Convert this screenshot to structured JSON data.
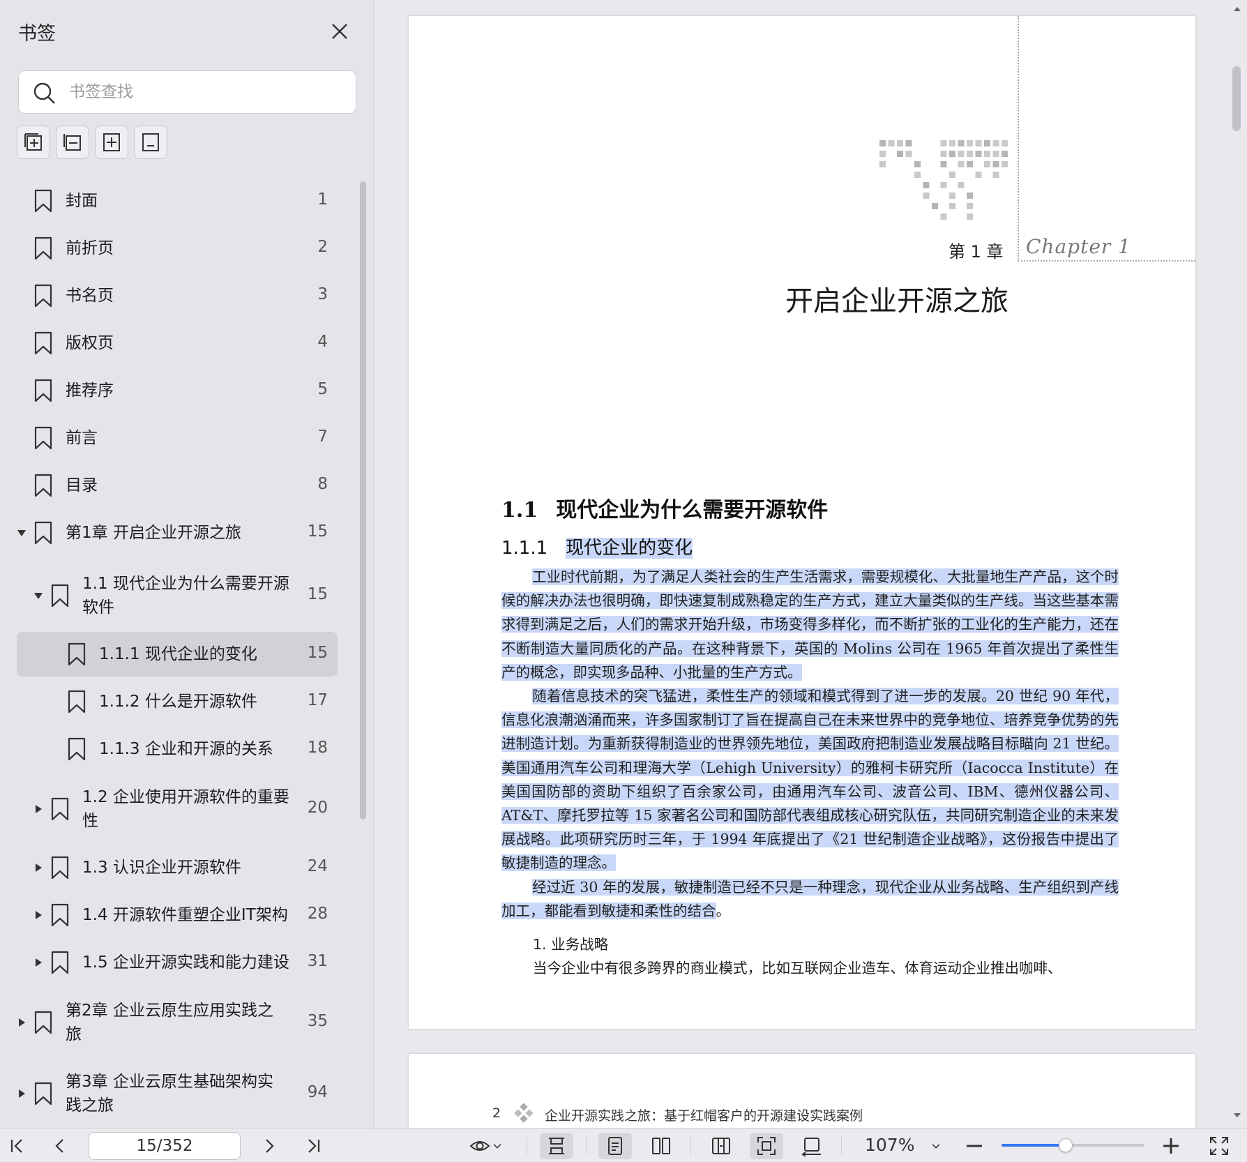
{
  "sidebar": {
    "title": "书签",
    "search_placeholder": "书签查找",
    "items": [
      {
        "label": "封面",
        "page": "1"
      },
      {
        "label": "前折页",
        "page": "2"
      },
      {
        "label": "书名页",
        "page": "3"
      },
      {
        "label": "版权页",
        "page": "4"
      },
      {
        "label": "推荐序",
        "page": "5"
      },
      {
        "label": "前言",
        "page": "7"
      },
      {
        "label": "目录",
        "page": "8"
      },
      {
        "label": "第1章 开启企业开源之旅",
        "page": "15"
      },
      {
        "label_line1": "1.1 现代企业为什么需要开源",
        "label_line2": "软件",
        "page": "15"
      },
      {
        "label": "1.1.1 现代企业的变化",
        "page": "15"
      },
      {
        "label": "1.1.2 什么是开源软件",
        "page": "17"
      },
      {
        "label": "1.1.3 企业和开源的关系",
        "page": "18"
      },
      {
        "label_line1": "1.2 企业使用开源软件的重要",
        "label_line2": "性",
        "page": "20"
      },
      {
        "label": "1.3 认识企业开源软件",
        "page": "24"
      },
      {
        "label": "1.4 开源软件重塑企业IT架构",
        "page": "28"
      },
      {
        "label": "1.5 企业开源实践和能力建设",
        "page": "31"
      },
      {
        "label_line1": "第2章 企业云原生应用实践之",
        "label_line2": "旅",
        "page": "35"
      },
      {
        "label_line1": "第3章 企业云原生基础架构实",
        "label_line2": "践之旅",
        "page": "94"
      }
    ]
  },
  "document": {
    "chapter_no": "第 1 章",
    "chapter_script": "Chapter 1",
    "chapter_title": "开启企业开源之旅",
    "section_num": "1.1",
    "section_title": "现代企业为什么需要开源软件",
    "subsection_num": "1.1.1",
    "subsection_title": "现代企业的变化",
    "p1": "工业时代前期，为了满足人类社会的生产生活需求，需要规模化、大批量地生产产品，这个时候的解决办法也很明确，即快速复制成熟稳定的生产方式，建立大量类似的生产线。当这些基本需求得到满足之后，人们的需求开始升级，市场变得多样化，而不断扩张的工业化的生产能力，还在不断制造大量同质化的产品。在这种背景下，英国的 Molins 公司在 1965 年首次提出了柔性生产的概念，即实现多品种、小批量的生产方式。",
    "p2": "随着信息技术的突飞猛进，柔性生产的领域和模式得到了进一步的发展。20 世纪 90 年代，信息化浪潮汹涌而来，许多国家制订了旨在提高自己在未来世界中的竞争地位、培养竞争优势的先进制造计划。为重新获得制造业的世界领先地位，美国政府把制造业发展战略目标瞄向 21 世纪。美国通用汽车公司和理海大学（Lehigh University）的雅柯卡研究所（Iacocca Institute）在美国国防部的资助下组织了百余家公司，由通用汽车公司、波音公司、IBM、德州仪器公司、AT&T、摩托罗拉等 15 家著名公司和国防部代表组成核心研究队伍，共同研究制造企业的未来发展战略。此项研究历时三年，于 1994 年底提出了《21 世纪制造企业战略》，这份报告中提出了敏捷制造的理念。",
    "p3_highlight": "经过近 30 年的发展，敏捷制造已经不只是一种理念，现代企业从业务战略、生产组织到产线加工，都能看到敏捷和柔性的结合",
    "p3_tail": "。",
    "list_heading": "1. 业务战略",
    "p4": "当今企业中有很多跨界的商业模式，比如互联网企业造车、体育运动企业推出咖啡、",
    "page2_num": "2",
    "page2_running_title": "企业开源实践之旅：基于红帽客户的开源建设实践案例"
  },
  "toolbar": {
    "page_value": "15/352",
    "zoom_label": "107%",
    "zoom_fraction": 0.45,
    "accent_color": "#3a78f2"
  }
}
